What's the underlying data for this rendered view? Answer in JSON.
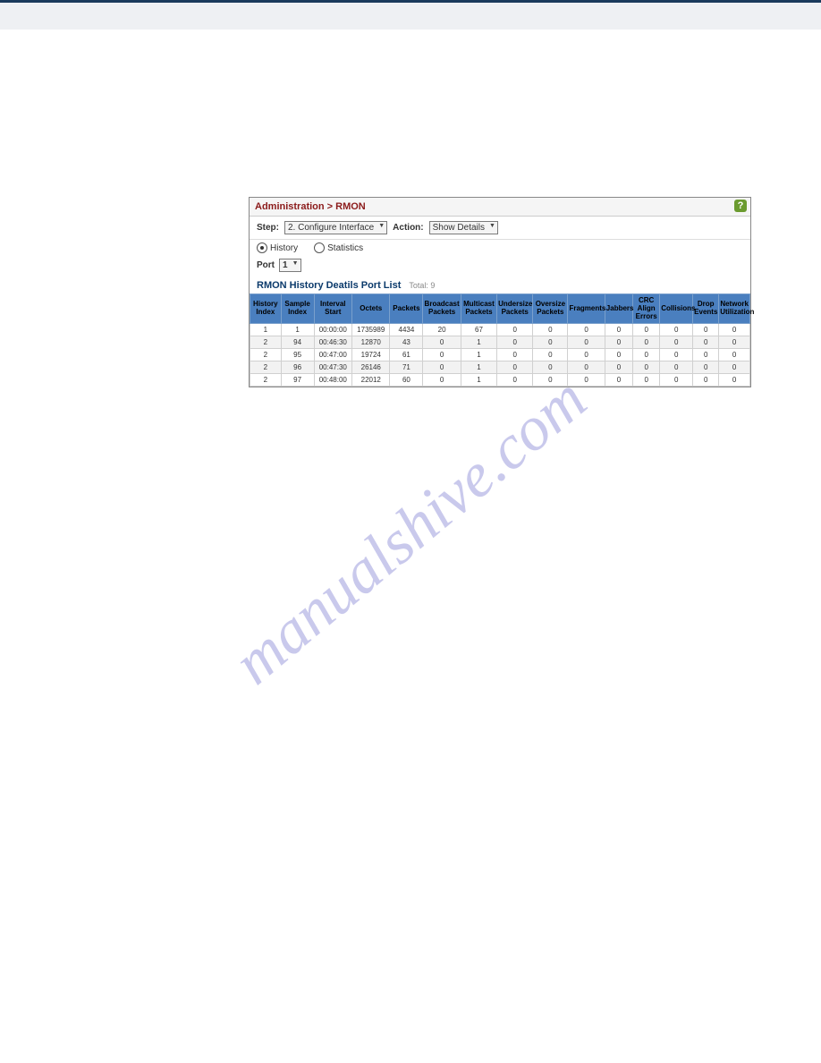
{
  "watermark": "manualshive.com",
  "breadcrumb": "Administration > RMON",
  "help": "?",
  "toolbar": {
    "step_label": "Step:",
    "step_value": "2. Configure Interface",
    "action_label": "Action:",
    "action_value": "Show Details"
  },
  "radios": {
    "history": "History",
    "statistics": "Statistics"
  },
  "port": {
    "label": "Port",
    "value": "1"
  },
  "subtitle": {
    "text": "RMON History Deatils Port List",
    "total": "Total: 9"
  },
  "headers": [
    "History Index",
    "Sample Index",
    "Interval Start",
    "Octets",
    "Packets",
    "Broadcast Packets",
    "Multicast Packets",
    "Undersize Packets",
    "Oversize Packets",
    "Fragments",
    "Jabbers",
    "CRC Align Errors",
    "Collisions",
    "Drop Events",
    "Network Utilization"
  ],
  "rows": [
    [
      "1",
      "1",
      "00:00:00",
      "1735989",
      "4434",
      "20",
      "67",
      "0",
      "0",
      "0",
      "0",
      "0",
      "0",
      "0",
      "0"
    ],
    [
      "2",
      "94",
      "00:46:30",
      "12870",
      "43",
      "0",
      "1",
      "0",
      "0",
      "0",
      "0",
      "0",
      "0",
      "0",
      "0"
    ],
    [
      "2",
      "95",
      "00:47:00",
      "19724",
      "61",
      "0",
      "1",
      "0",
      "0",
      "0",
      "0",
      "0",
      "0",
      "0",
      "0"
    ],
    [
      "2",
      "96",
      "00:47:30",
      "26146",
      "71",
      "0",
      "1",
      "0",
      "0",
      "0",
      "0",
      "0",
      "0",
      "0",
      "0"
    ],
    [
      "2",
      "97",
      "00:48:00",
      "22012",
      "60",
      "0",
      "1",
      "0",
      "0",
      "0",
      "0",
      "0",
      "0",
      "0",
      "0"
    ]
  ]
}
